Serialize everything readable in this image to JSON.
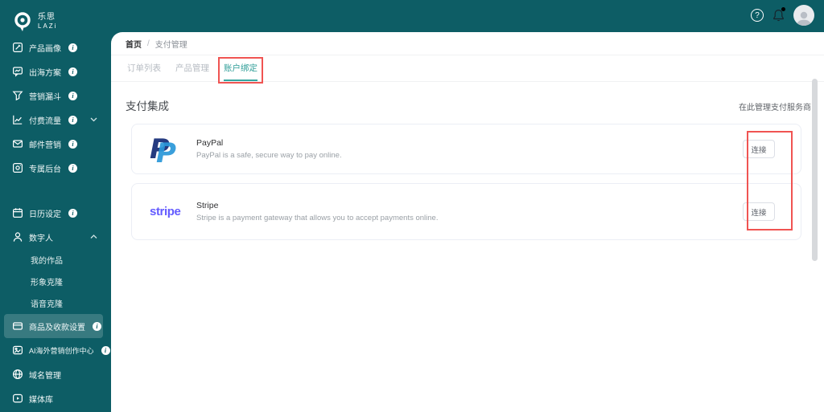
{
  "brand": {
    "logo_cn": "乐思",
    "logo_en": "LAZi"
  },
  "topbar": {
    "help_icon": "?"
  },
  "sidebar": {
    "items": [
      {
        "label": "产品画像",
        "icon": "edit-square-icon",
        "info": true
      },
      {
        "label": "出海方案",
        "icon": "chat-chart-icon",
        "info": true
      },
      {
        "label": "营销漏斗",
        "icon": "funnel-icon",
        "info": true
      },
      {
        "label": "付费流量",
        "icon": "line-chart-icon",
        "info": true,
        "chevron": "down"
      },
      {
        "label": "邮件营销",
        "icon": "envelope-icon",
        "info": true
      },
      {
        "label": "专属后台",
        "icon": "camera-square-icon",
        "info": true
      },
      {
        "label": "日历设定",
        "icon": "calendar-icon",
        "info": true
      },
      {
        "label": "数字人",
        "icon": "person-icon",
        "chevron": "up"
      },
      {
        "label": "我的作品",
        "sub": true
      },
      {
        "label": "形象克隆",
        "sub": true
      },
      {
        "label": "语音克隆",
        "sub": true
      },
      {
        "label": "商品及收款设置",
        "icon": "credit-card-icon",
        "info": true,
        "active": true
      },
      {
        "label": "AI海外营销创作中心",
        "icon": "photo-icon",
        "info": true
      },
      {
        "label": "域名管理",
        "icon": "globe-icon"
      },
      {
        "label": "媒体库",
        "icon": "media-icon"
      }
    ]
  },
  "breadcrumb": {
    "home": "首页",
    "separator": "/",
    "current": "支付管理"
  },
  "tabs": [
    {
      "label": "订单列表"
    },
    {
      "label": "产品管理"
    },
    {
      "label": "账户绑定",
      "active": true,
      "highlighted": true
    }
  ],
  "payments": {
    "section_title": "支付集成",
    "hint": "在此管理支付服务商",
    "providers": [
      {
        "name": "PayPal",
        "description": "PayPal is a safe, secure way to pay online.",
        "action": "连接"
      },
      {
        "name": "Stripe",
        "logo_text": "stripe",
        "description": "Stripe is a payment gateway that allows you to accept payments online.",
        "action": "连接"
      }
    ]
  },
  "colors": {
    "sidebar_teal": "#0d5d65",
    "active_teal": "#2f9e98",
    "highlight_red": "#f05452",
    "paypal_navy": "#253b80",
    "paypal_blue": "#2997d8",
    "stripe_purple": "#635bff"
  }
}
